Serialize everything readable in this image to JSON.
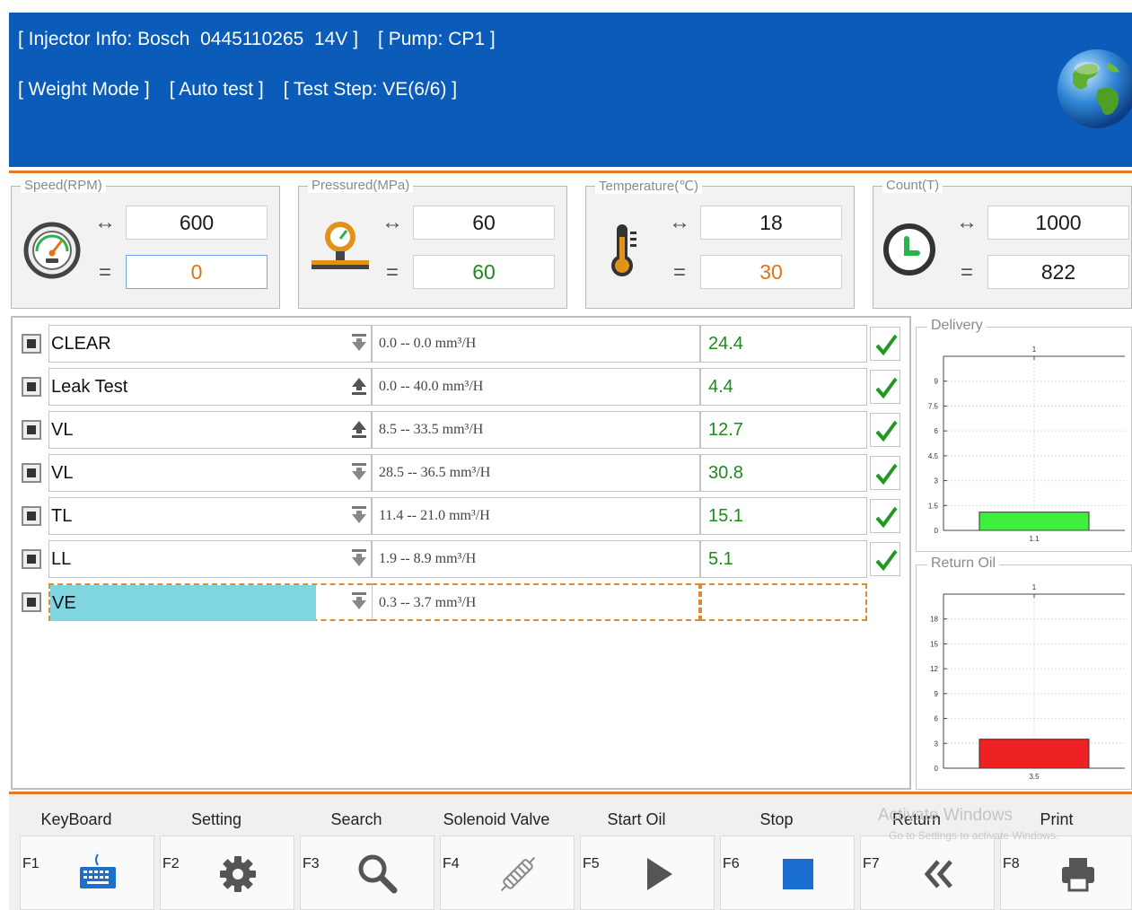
{
  "header": {
    "injector_info": "[ Injector Info: Bosch  0445110265  14V ]",
    "pump": "[ Pump: CP1 ]",
    "mode": "[ Weight Mode ]",
    "auto_test": "[ Auto test ]",
    "test_step": "[ Test Step: VE(6/6) ]",
    "bg_color": "#0b5cb8"
  },
  "gauges": [
    {
      "title": "Speed(RPM)",
      "icon": "speedometer-icon",
      "target": "600",
      "actual": "0"
    },
    {
      "title": "Pressured(MPa)",
      "icon": "pressure-gauge-icon",
      "target": "60",
      "actual": "60"
    },
    {
      "title": "Temperature(℃)",
      "icon": "thermometer-icon",
      "target": "18",
      "actual": "30"
    },
    {
      "title": "Count(T)",
      "icon": "clock-icon",
      "target": "1000",
      "actual": "822"
    }
  ],
  "symbols": {
    "target": "↔",
    "actual": "="
  },
  "tests": [
    {
      "name": "CLEAR",
      "direction": "down",
      "range": "0.0 -- 0.0 mm³/H",
      "result": "24.4",
      "passed": true
    },
    {
      "name": "Leak Test",
      "direction": "up",
      "range": "0.0 -- 40.0 mm³/H",
      "result": "4.4",
      "passed": true
    },
    {
      "name": "VL",
      "direction": "up",
      "range": "8.5 -- 33.5 mm³/H",
      "result": "12.7",
      "passed": true
    },
    {
      "name": "VL",
      "direction": "down",
      "range": "28.5 -- 36.5 mm³/H",
      "result": "30.8",
      "passed": true
    },
    {
      "name": "TL",
      "direction": "down",
      "range": "11.4 -- 21.0 mm³/H",
      "result": "15.1",
      "passed": true
    },
    {
      "name": "LL",
      "direction": "down",
      "range": "1.9 -- 8.9 mm³/H",
      "result": "5.1",
      "passed": true
    },
    {
      "name": "VE",
      "direction": "down",
      "range": "0.3 -- 3.7 mm³/H",
      "result": "",
      "passed": false,
      "active": true
    }
  ],
  "chart_data": [
    {
      "type": "bar",
      "title": "Delivery",
      "categories": [
        "1"
      ],
      "values": [
        1.1
      ],
      "value_labels": [
        "1.1"
      ],
      "yticks": [
        "0",
        "1.5",
        "3",
        "4.5",
        "6",
        "7.5",
        "9"
      ],
      "ylim": [
        0,
        10.5
      ],
      "bar_color": "#3ef03e",
      "grid": true
    },
    {
      "type": "bar",
      "title": "Return Oil",
      "categories": [
        "1"
      ],
      "values": [
        3.5
      ],
      "value_labels": [
        "3.5"
      ],
      "yticks": [
        "0",
        "3",
        "6",
        "9",
        "12",
        "15",
        "18"
      ],
      "ylim": [
        0,
        21
      ],
      "bar_color": "#ee2222",
      "grid": true
    }
  ],
  "toolbar": [
    {
      "label": "KeyBoard",
      "key": "F1",
      "icon": "keyboard-icon"
    },
    {
      "label": "Setting",
      "key": "F2",
      "icon": "gear-icon"
    },
    {
      "label": "Search",
      "key": "F3",
      "icon": "search-icon"
    },
    {
      "label": "Solenoid Valve",
      "key": "F4",
      "icon": "solenoid-valve-icon"
    },
    {
      "label": "Start Oil",
      "key": "F5",
      "icon": "play-icon"
    },
    {
      "label": "Stop",
      "key": "F6",
      "icon": "stop-icon"
    },
    {
      "label": "Return",
      "key": "F7",
      "icon": "return-icon"
    },
    {
      "label": "Print",
      "key": "F8",
      "icon": "printer-icon"
    }
  ],
  "watermark": {
    "line1": "Activate Windows",
    "line2": "Go to Settings to activate Windows."
  },
  "colors": {
    "accent_orange": "#e87722",
    "pass_green": "#1d8a1d",
    "active_row_highlight": "#7fd6e0"
  }
}
